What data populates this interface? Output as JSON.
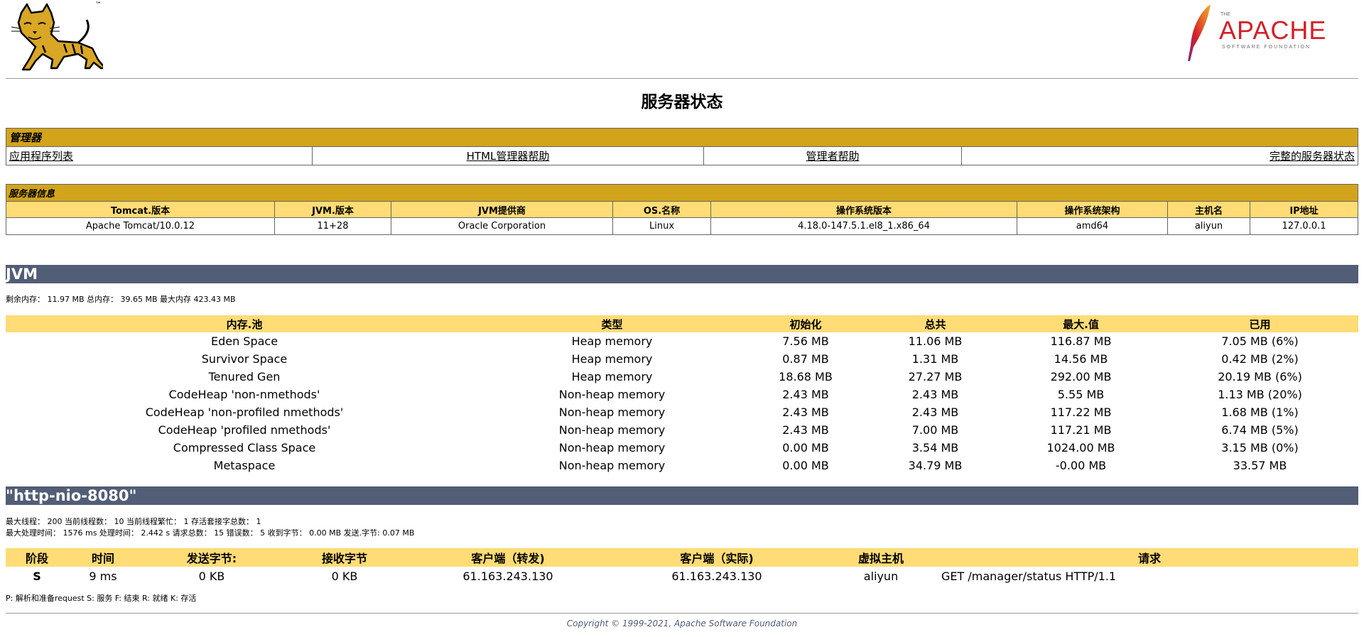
{
  "brand": {
    "tomcat_tm": "™",
    "apache_the": "THE",
    "apache_name": "APACHE",
    "apache_tagline": "SOFTWARE FOUNDATION"
  },
  "page_title": "服务器状态",
  "manager": {
    "section_title": "管理器",
    "links": [
      "应用程序列表",
      "HTML管理器帮助",
      "管理者帮助",
      "完整的服务器状态"
    ]
  },
  "server_info": {
    "section_title": "服务器信息",
    "headers": [
      "Tomcat.版本",
      "JVM.版本",
      "JVM提供商",
      "OS.名称",
      "操作系统版本",
      "操作系统架构",
      "主机名",
      "IP地址"
    ],
    "values": [
      "Apache Tomcat/10.0.12",
      "11+28",
      "Oracle Corporation",
      "Linux",
      "4.18.0-147.5.1.el8_1.x86_64",
      "amd64",
      "aliyun",
      "127.0.0.1"
    ]
  },
  "jvm": {
    "title": "JVM",
    "memory_summary": "剩余内存： 11.97 MB 总内存： 39.65 MB 最大内存 423.43 MB",
    "pool_headers": [
      "内存.池",
      "类型",
      "初始化",
      "总共",
      "最大.值",
      "已用"
    ],
    "pools": [
      [
        "Eden Space",
        "Heap memory",
        "7.56 MB",
        "11.06 MB",
        "116.87 MB",
        "7.05 MB (6%)"
      ],
      [
        "Survivor Space",
        "Heap memory",
        "0.87 MB",
        "1.31 MB",
        "14.56 MB",
        "0.42 MB (2%)"
      ],
      [
        "Tenured Gen",
        "Heap memory",
        "18.68 MB",
        "27.27 MB",
        "292.00 MB",
        "20.19 MB (6%)"
      ],
      [
        "CodeHeap 'non-nmethods'",
        "Non-heap memory",
        "2.43 MB",
        "2.43 MB",
        "5.55 MB",
        "1.13 MB (20%)"
      ],
      [
        "CodeHeap 'non-profiled nmethods'",
        "Non-heap memory",
        "2.43 MB",
        "2.43 MB",
        "117.22 MB",
        "1.68 MB (1%)"
      ],
      [
        "CodeHeap 'profiled nmethods'",
        "Non-heap memory",
        "2.43 MB",
        "7.00 MB",
        "117.21 MB",
        "6.74 MB (5%)"
      ],
      [
        "Compressed Class Space",
        "Non-heap memory",
        "0.00 MB",
        "3.54 MB",
        "1024.00 MB",
        "3.15 MB (0%)"
      ],
      [
        "Metaspace",
        "Non-heap memory",
        "0.00 MB",
        "34.79 MB",
        "-0.00 MB",
        "33.57 MB"
      ]
    ]
  },
  "connector": {
    "title": "\"http-nio-8080\"",
    "line1": "最大线程： 200 当前线程数： 10 当前线程繁忙： 1 存活套接字总数： 1",
    "line2": "最大处理时间： 1576 ms 处理时间： 2.442 s 请求总数： 15 错误数： 5 收到字节： 0.00 MB 发送.字节: 0.07 MB",
    "req_headers": [
      "阶段",
      "时间",
      "发送字节:",
      "接收字节",
      "客户端（转发)",
      "客户端（实际)",
      "虚拟主机",
      "请求"
    ],
    "requests": [
      [
        "S",
        "9 ms",
        "0 KB",
        "0 KB",
        "61.163.243.130",
        "61.163.243.130",
        "aliyun",
        "GET /manager/status HTTP/1.1"
      ]
    ],
    "legend": "P: 解析和准备request S: 服务 F: 结束 R: 就绪 K: 存活"
  },
  "footer": "Copyright © 1999-2021, Apache Software Foundation",
  "colors": {
    "section_gold": "#D2A41C",
    "header_yellow": "#FFDC75",
    "band_slate": "#525D76"
  }
}
